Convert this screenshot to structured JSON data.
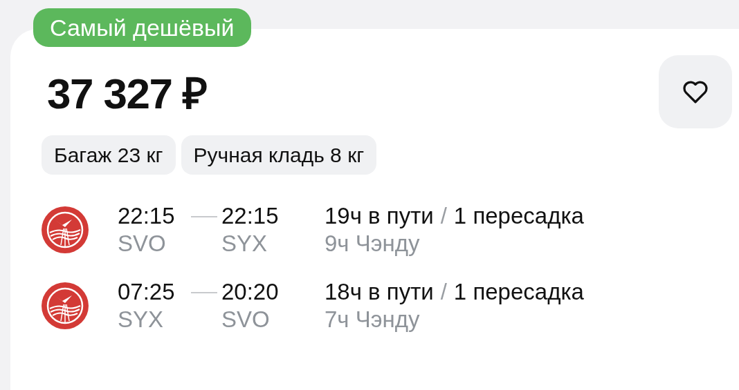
{
  "badge": "Самый дешёвый",
  "price": "37 327 ₽",
  "favorite": {
    "selected": false
  },
  "tags": [
    "Багаж 23 кг",
    "Ручная кладь 8 кг"
  ],
  "segments": [
    {
      "depart_time": "22:15",
      "arrive_time": "22:15",
      "from": "SVO",
      "to": "SYX",
      "duration": "19ч в пути",
      "separator": "/",
      "stops": "1 пересадка",
      "layover": "9ч Чэнду"
    },
    {
      "depart_time": "07:25",
      "arrive_time": "20:20",
      "from": "SYX",
      "to": "SVO",
      "duration": "18ч в пути",
      "separator": "/",
      "stops": "1 пересадка",
      "layover": "7ч Чэнду"
    }
  ]
}
